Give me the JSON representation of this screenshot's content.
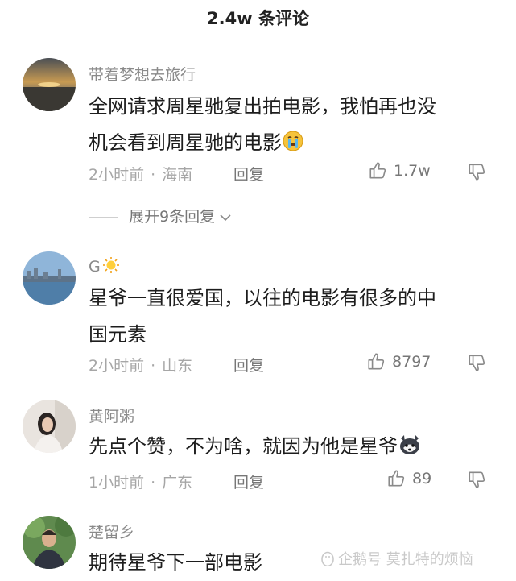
{
  "header": {
    "title": "2.4w 条评论"
  },
  "comments": [
    {
      "username": "带着梦想去旅行",
      "text_line1": "全网请求周星驰复出拍电影，我怕再也没",
      "text_line2": "机会看到周星驰的电影",
      "emoji": "crying-face-icon",
      "time": "2小时前",
      "location": "海南",
      "reply_label": "回复",
      "likes": "1.7w",
      "expand_label": "展开9条回复"
    },
    {
      "username": "G",
      "username_emoji": "sun-icon",
      "text_line1": "星爷一直很爱国，以往的电影有很多的中",
      "text_line2": "国元素",
      "time": "2小时前",
      "location": "山东",
      "reply_label": "回复",
      "likes": "8797"
    },
    {
      "username": "黄阿粥",
      "text_line1": "先点个赞，不为啥，就因为他是星爷",
      "emoji": "husky-dog-icon",
      "time": "1小时前",
      "location": "广东",
      "reply_label": "回复",
      "likes": "89"
    },
    {
      "username": "楚留乡",
      "text_line1": "期待星爷下一部电影"
    }
  ],
  "watermark": "企鹅号 莫扎特的烦恼",
  "colors": {
    "text": "#1d1d1d",
    "meta": "#a6a6a6",
    "username": "#8a8a8a"
  }
}
